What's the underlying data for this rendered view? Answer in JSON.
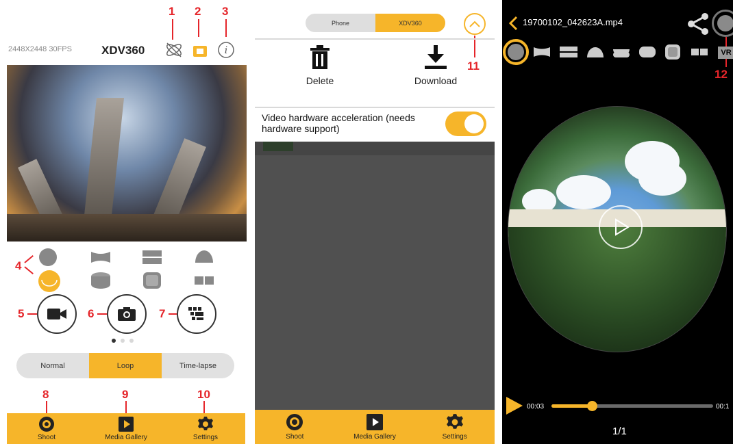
{
  "panel1": {
    "resolution": "2448X2448 30FPS",
    "device_name": "XDV360",
    "annotations": [
      "1",
      "2",
      "3",
      "4",
      "5",
      "6",
      "7",
      "8",
      "9",
      "10"
    ],
    "modes": [
      "Normal",
      "Loop",
      "Time-lapse"
    ],
    "selected_mode": "Loop",
    "tabs": [
      {
        "label": "Shoot",
        "icon": "camera-lens-icon"
      },
      {
        "label": "Media Gallery",
        "icon": "play-icon"
      },
      {
        "label": "Settings",
        "icon": "gear-icon"
      }
    ]
  },
  "panel2": {
    "source_tabs": [
      "Phone",
      "XDV360"
    ],
    "selected_source": "XDV360",
    "annotation": "11",
    "delete_label": "Delete",
    "download_label": "Download",
    "hw_accel_label": "Video hardware acceleration (needs hardware support)",
    "hw_accel_on": true,
    "tabs": [
      {
        "label": "Shoot",
        "icon": "camera-lens-icon"
      },
      {
        "label": "Media Gallery",
        "icon": "play-icon"
      },
      {
        "label": "Settings",
        "icon": "gear-icon"
      }
    ]
  },
  "panel3": {
    "file_name": "19700102_042623A.mp4",
    "annotation": "12",
    "vr_label": "VR",
    "current_time": "00:03",
    "total_time": "00:1",
    "progress": 0.25,
    "page_indicator": "1/1"
  },
  "colors": {
    "accent": "#f6b52a",
    "annotation_red": "#e5252a"
  }
}
